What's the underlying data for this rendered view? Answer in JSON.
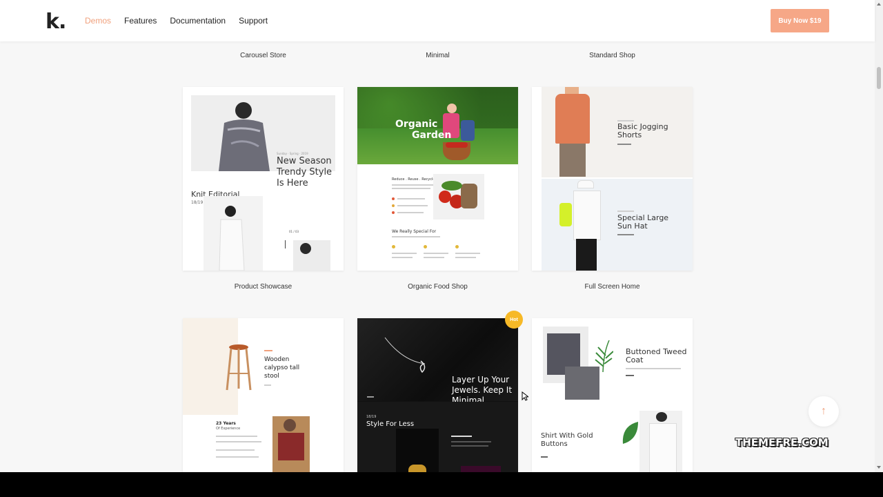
{
  "nav": {
    "logo": "k.",
    "items": [
      "Demos",
      "Features",
      "Documentation",
      "Support"
    ],
    "buy_label": "Buy Now $19"
  },
  "top_labels": [
    "Carousel Store",
    "Minimal",
    "Standard Shop"
  ],
  "row1": {
    "product_showcase": {
      "label": "Product Showcase",
      "tagline_small": "Sunday · Spring · 2019",
      "headline": "New Season Trendy Style Is Here",
      "title": "Knit Editorial",
      "date": "18/19",
      "counter": "01 / 03"
    },
    "organic": {
      "label": "Organic Food Shop",
      "hero_line1": "Organic",
      "hero_line2": "Garden",
      "section1": "Reduce . Reuse . Recycle",
      "section2": "We Really Special For"
    },
    "fullscreen": {
      "label": "Full Screen Home",
      "item1": "Basic Jogging Shorts",
      "item2": "Special Large Sun Hat"
    }
  },
  "row2": {
    "stool": {
      "title": "Wooden calypso tall stool",
      "years": "23 Years",
      "years_sub": "Of Experience"
    },
    "jewels": {
      "badge": "Hot",
      "headline": "Layer Up Your Jewels. Keep It Minimal",
      "date": "18/19",
      "sub": "Style For Less"
    },
    "coat": {
      "title1": "Buttoned Tweed Coat",
      "title2": "Shirt With Gold Buttons"
    }
  },
  "watermark": "THEMEFRE.COM",
  "colors": {
    "accent": "#f0a07c",
    "buy_bg": "#f6a787",
    "hot_badge": "#f7b927"
  }
}
